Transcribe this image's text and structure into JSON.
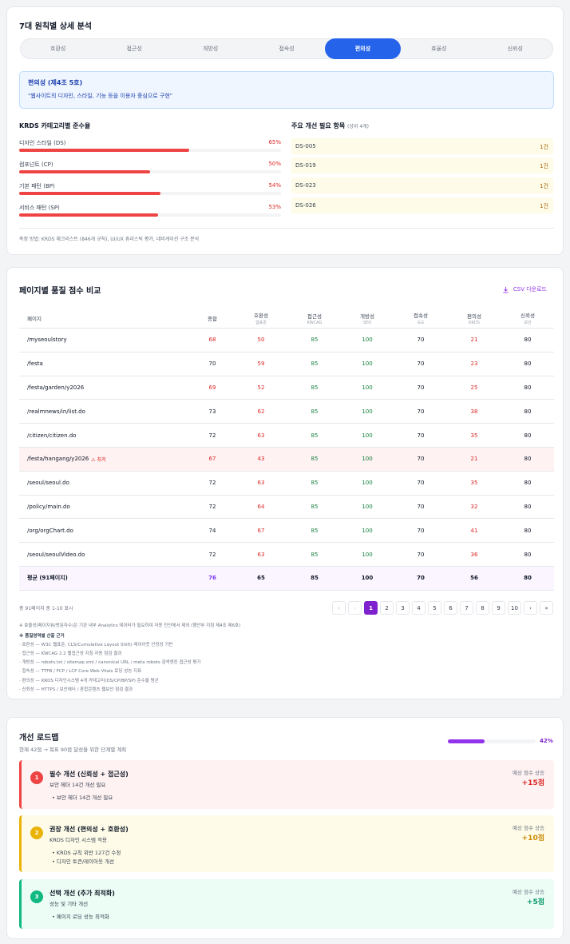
{
  "principles": {
    "title": "7대 원칙별 상세 분석",
    "tabs": [
      "호환성",
      "접근성",
      "개방성",
      "접속성",
      "편의성",
      "효율성",
      "신뢰성"
    ],
    "active_index": 4,
    "box_title": "편의성 (제4조 5호)",
    "box_desc": "\"웹사이트의 디자인, 스타일, 기능 등을 이용자 중심으로 구현\"",
    "krds_title": "KRDS 카테고리별 준수율",
    "krds": [
      {
        "label": "디자인 스타일 (DS)",
        "pct": "65%",
        "value": 65
      },
      {
        "label": "컴포넌트 (CP)",
        "pct": "50%",
        "value": 50
      },
      {
        "label": "기본 패턴 (BP)",
        "pct": "54%",
        "value": 54
      },
      {
        "label": "서비스 패턴 (SP)",
        "pct": "53%",
        "value": 53
      }
    ],
    "improve_title": "주요 개선 필요 항목",
    "improve_sub": "(상위 4개)",
    "improve": [
      {
        "code": "DS-005",
        "count": "1건"
      },
      {
        "code": "DS-019",
        "count": "1건"
      },
      {
        "code": "DS-023",
        "count": "1건"
      },
      {
        "code": "DS-026",
        "count": "1건"
      }
    ],
    "method_note": "측정 방법: KRDS 체크리스트 (846개 규칙), UI/UX 휴리스틱 평가, 네비게이션 구조 분석"
  },
  "table": {
    "title": "페이지별 품질 점수 비교",
    "csv_label": "CSV 다운로드",
    "headers": [
      {
        "label": "페이지",
        "sub": ""
      },
      {
        "label": "종합",
        "sub": ""
      },
      {
        "label": "호환성",
        "sub": "웹표준"
      },
      {
        "label": "접근성",
        "sub": "KWCAG"
      },
      {
        "label": "개방성",
        "sub": "SEO"
      },
      {
        "label": "접속성",
        "sub": "속도"
      },
      {
        "label": "편의성",
        "sub": "KRDS"
      },
      {
        "label": "신뢰성",
        "sub": "보안"
      }
    ],
    "rows": [
      {
        "page": "/myseoulstory",
        "total": "68",
        "c1": "50",
        "c2": "85",
        "c3": "100",
        "c4": "70",
        "c5": "21",
        "c6": "80",
        "flag": ""
      },
      {
        "page": "/festa",
        "total": "70",
        "c1": "59",
        "c2": "85",
        "c3": "100",
        "c4": "70",
        "c5": "23",
        "c6": "80",
        "flag": ""
      },
      {
        "page": "/festa/garden/y2026",
        "total": "69",
        "c1": "52",
        "c2": "85",
        "c3": "100",
        "c4": "70",
        "c5": "25",
        "c6": "80",
        "flag": ""
      },
      {
        "page": "/realmnews/in/list.do",
        "total": "73",
        "c1": "62",
        "c2": "85",
        "c3": "100",
        "c4": "70",
        "c5": "38",
        "c6": "80",
        "flag": ""
      },
      {
        "page": "/citizen/citizen.do",
        "total": "72",
        "c1": "63",
        "c2": "85",
        "c3": "100",
        "c4": "70",
        "c5": "35",
        "c6": "80",
        "flag": ""
      },
      {
        "page": "/festa/hangang/y2026",
        "total": "67",
        "c1": "43",
        "c2": "85",
        "c3": "100",
        "c4": "70",
        "c5": "21",
        "c6": "80",
        "flag": "⚠ 최저"
      },
      {
        "page": "/seoul/seoul.do",
        "total": "72",
        "c1": "63",
        "c2": "85",
        "c3": "100",
        "c4": "70",
        "c5": "35",
        "c6": "80",
        "flag": ""
      },
      {
        "page": "/policy/main.do",
        "total": "72",
        "c1": "64",
        "c2": "85",
        "c3": "100",
        "c4": "70",
        "c5": "32",
        "c6": "80",
        "flag": ""
      },
      {
        "page": "/org/orgChart.do",
        "total": "74",
        "c1": "67",
        "c2": "85",
        "c3": "100",
        "c4": "70",
        "c5": "41",
        "c6": "80",
        "flag": ""
      },
      {
        "page": "/seoul/seoulVideo.do",
        "total": "72",
        "c1": "63",
        "c2": "85",
        "c3": "100",
        "c4": "70",
        "c5": "36",
        "c6": "80",
        "flag": ""
      }
    ],
    "avg": {
      "page": "평균 (91페이지)",
      "total": "76",
      "c1": "65",
      "c2": "85",
      "c3": "100",
      "c4": "70",
      "c5": "56",
      "c6": "80"
    },
    "pager_info": "총 91페이지 중 1-10 표시",
    "pages": [
      "«",
      "‹",
      "1",
      "2",
      "3",
      "4",
      "5",
      "6",
      "7",
      "8",
      "9",
      "10",
      "›",
      "»"
    ],
    "current_page": "1",
    "notes": [
      "※ 효율성(페이지뷰/방문자수)은 기관 내부 Analytics 데이터가 필요하여 자동 진단에서 제외 (행안부 지침 제4조 제6호)",
      "※ 품질영역별 산출 근거",
      "· 호환성 — W3C 웹표준, CLS(Cumulative Layout Shift) 레이아웃 안정성 기반",
      "· 접근성 — KWCAG 2.2 웹접근성 지침 자동 점검 결과",
      "· 개방성 — robots.txt / sitemap.xml / canonical URL / meta robots 검색엔진 접근성 평가",
      "· 접속성 — TTFB / FCP / LCP Core Web Vitals 로딩 성능 지표",
      "· 편의성 — KRDS 디자인시스템 4개 카테고리(DS/CP/BP/SP) 준수율 평균",
      "· 신뢰성 — HTTPS / 보안헤더 / 혼합콘텐츠 웹보안 점검 결과"
    ]
  },
  "roadmap": {
    "title": "개선 로드맵",
    "subtitle": "현재 42점 → 목표 90점 달성을 위한 단계별 계획",
    "progress_label": "42%",
    "progress_value": 42,
    "expected_label": "예상 점수 상승",
    "steps": [
      {
        "num": "1",
        "title": "필수 개선 (신뢰성 + 접근성)",
        "sub": "보안 헤더 14건 개선 필요",
        "items": [
          "• 보안 헤더 14건 개선 필요"
        ],
        "gain": "+15점"
      },
      {
        "num": "2",
        "title": "권장 개선 (편의성 + 호환성)",
        "sub": "KRDS 디자인 시스템 적용",
        "items": [
          "• KRDS 규칙 위반 127건 수정",
          "• 디자인 토큰/레이아웃 개선"
        ],
        "gain": "+10점"
      },
      {
        "num": "3",
        "title": "선택 개선 (추가 최적화)",
        "sub": "성능 및 기타 개선",
        "items": [
          "• 페이지 로딩 성능 최적화"
        ],
        "gain": "+5점"
      }
    ]
  }
}
